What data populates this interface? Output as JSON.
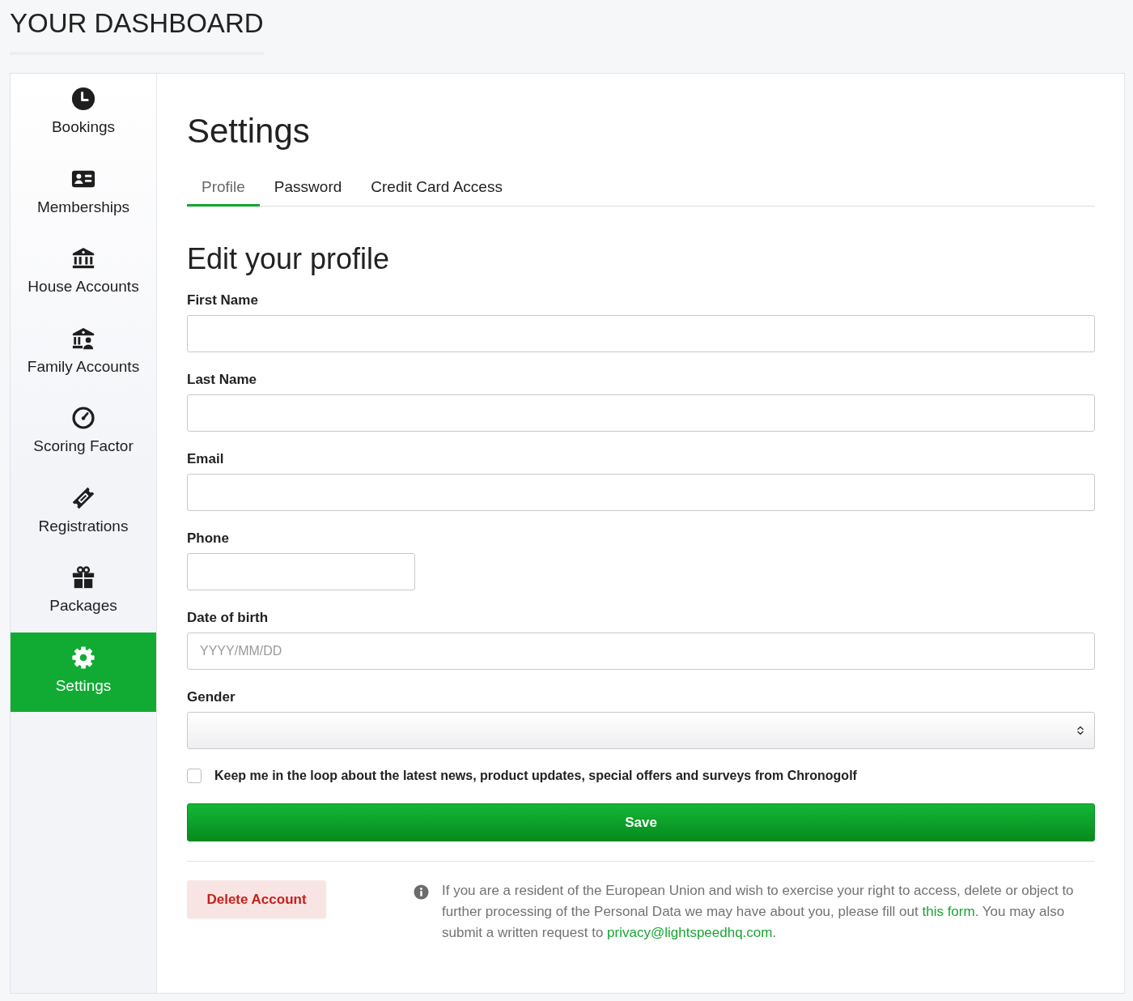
{
  "page_title": "YOUR DASHBOARD",
  "sidebar": {
    "items": [
      {
        "label": "Bookings",
        "selected": false
      },
      {
        "label": "Memberships",
        "selected": false
      },
      {
        "label": "House Accounts",
        "selected": false
      },
      {
        "label": "Family Accounts",
        "selected": false
      },
      {
        "label": "Scoring Factor",
        "selected": false
      },
      {
        "label": "Registrations",
        "selected": false
      },
      {
        "label": "Packages",
        "selected": false
      },
      {
        "label": "Settings",
        "selected": true
      }
    ]
  },
  "settings": {
    "title": "Settings",
    "tabs": [
      {
        "label": "Profile",
        "selected": true
      },
      {
        "label": "Password",
        "selected": false
      },
      {
        "label": "Credit Card Access",
        "selected": false
      }
    ],
    "section_title": "Edit your profile",
    "fields": [
      {
        "kind": "text",
        "label": "First Name"
      },
      {
        "kind": "text",
        "label": "Last Name"
      },
      {
        "kind": "text",
        "label": "Email"
      },
      {
        "kind": "phone",
        "label": "Phone"
      },
      {
        "kind": "date",
        "label": "Date of birth",
        "placeholder": "YYYY/MM/DD"
      },
      {
        "kind": "select",
        "label": "Gender"
      }
    ],
    "newsletter": {
      "label": "Keep me in the loop about the latest news, product updates, special offers and surveys from Chronogolf",
      "checked": false
    },
    "save_button": "Save",
    "delete_button": "Delete Account",
    "privacy_notice": [
      {
        "kind": "text",
        "text": "If you are a resident of the European Union and wish to exercise your right to access, delete or object to further processing of the Personal Data we may have about you, please fill out "
      },
      {
        "kind": "link",
        "text": "this form"
      },
      {
        "kind": "text",
        "text": ". You may also submit a written request to "
      },
      {
        "kind": "link",
        "text": "privacy@lightspeedhq.com"
      },
      {
        "kind": "text",
        "text": "."
      }
    ]
  }
}
